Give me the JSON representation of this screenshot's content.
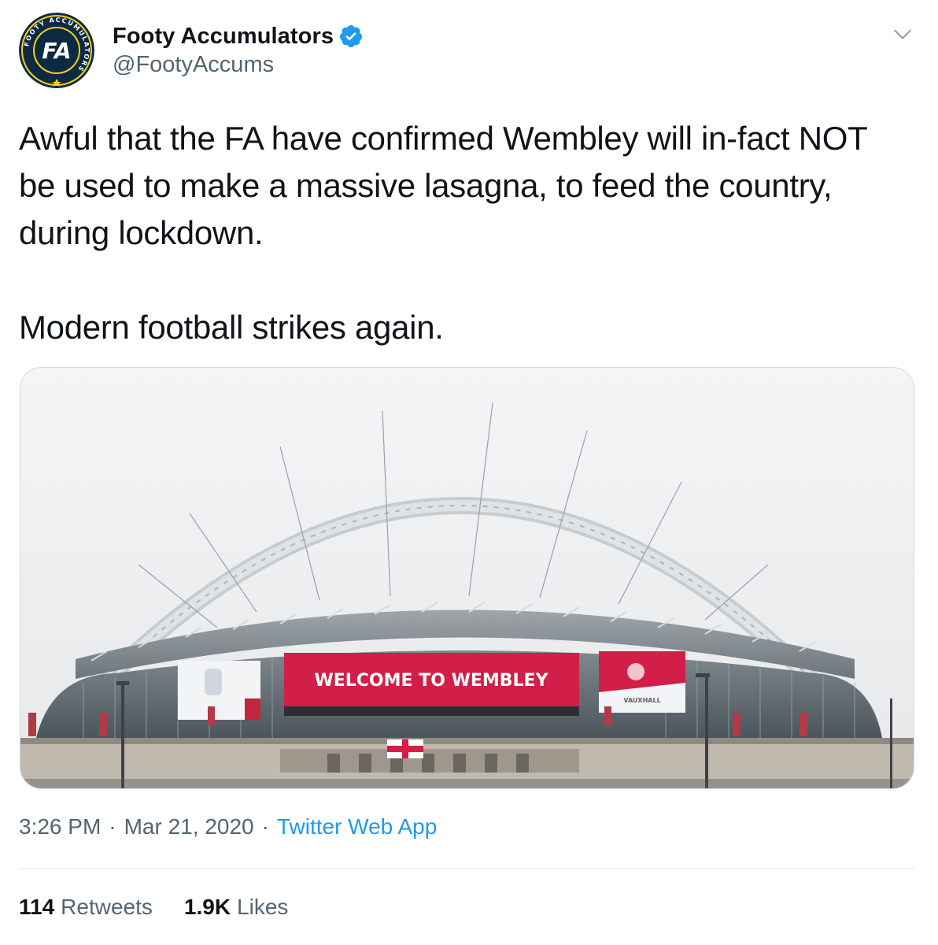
{
  "author": {
    "display_name": "Footy Accumulators",
    "handle": "@FootyAccums",
    "verified": true,
    "avatar": {
      "ring_text": "FOOTY ACCUMULATORS",
      "monogram": "FA",
      "bg_color": "#0d2a43",
      "ring_color": "#1f3a56",
      "accent_color": "#f4cf1a"
    }
  },
  "tweet": {
    "text": "Awful that the FA have confirmed Wembley will in-fact NOT be used to make a massive lasagna, to feed the country, during lockdown.\n\nModern football strikes again.",
    "time": "3:26 PM",
    "separator": "·",
    "date": "Mar 21, 2020",
    "source": "Twitter Web App"
  },
  "media": {
    "screen_text": "WELCOME TO WEMBLEY",
    "right_screen_text": "VAUXHALL"
  },
  "stats": {
    "retweets_count": "114",
    "retweets_label": "Retweets",
    "likes_count": "1.9K",
    "likes_label": "Likes"
  },
  "colors": {
    "verified_blue": "#1d9bf0",
    "link_blue": "#1d9bf0",
    "secondary_text": "#536471",
    "screen_red": "#d11f47"
  },
  "icons": {
    "verified": "verified-badge-icon",
    "more": "chevron-down-icon"
  }
}
